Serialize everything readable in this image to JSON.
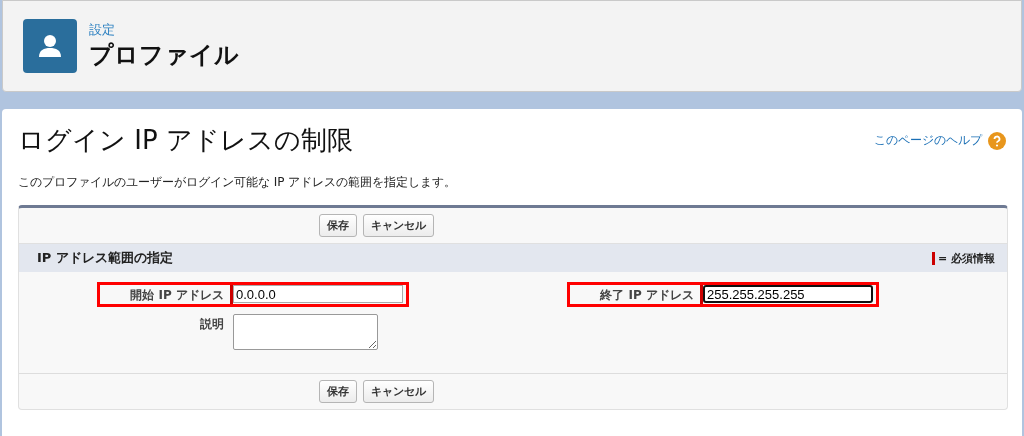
{
  "header": {
    "breadcrumb": "設定",
    "title": "プロファイル"
  },
  "page": {
    "title": "ログイン IP アドレスの制限",
    "help_link": "このページのヘルプ",
    "description": "このプロファイルのユーザーがログイン可能な IP アドレスの範囲を指定します。"
  },
  "top_buttons": [
    "保存",
    "キャンセル"
  ],
  "section": {
    "title": "IP アドレス範囲の指定",
    "required_legend": "= 必須情報"
  },
  "left_fields": [
    {
      "label": "開始 IP アドレス",
      "value": "0.0.0.0",
      "kind": "input",
      "required": true,
      "focused": false,
      "highlighted": true
    },
    {
      "label": "説明",
      "kind": "textarea",
      "required": false,
      "highlighted": false
    }
  ],
  "right_fields": [
    {
      "label": "終了 IP アドレス",
      "value": "255.255.255.255",
      "kind": "input",
      "required": true,
      "focused": true,
      "highlighted": true
    }
  ],
  "bottom_buttons": [
    "保存",
    "キャンセル"
  ]
}
